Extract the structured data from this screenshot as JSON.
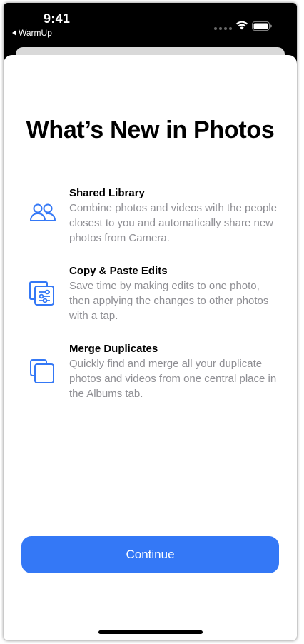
{
  "status_bar": {
    "time": "9:41",
    "back_label": "WarmUp"
  },
  "page_title": "What’s New in Photos",
  "features": [
    {
      "title": "Shared Library",
      "description": "Combine photos and videos with the people closest to you and automatically share new photos from Camera.",
      "icon": "people-icon"
    },
    {
      "title": "Copy & Paste Edits",
      "description": "Save time by making edits to one photo, then applying the changes to other photos with a tap.",
      "icon": "edit-sliders-stack-icon"
    },
    {
      "title": "Merge Duplicates",
      "description": "Quickly find and merge all your duplicate photos and videos from one central place in the Albums tab.",
      "icon": "duplicate-squares-icon"
    }
  ],
  "continue_label": "Continue",
  "colors": {
    "accent": "#3478f6",
    "secondary_text": "#8e8e93"
  }
}
